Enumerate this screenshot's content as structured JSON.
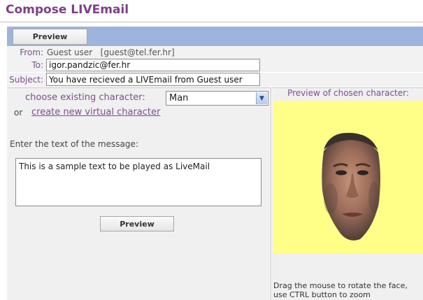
{
  "header": {
    "title": "Compose LIVEmail"
  },
  "toolbar": {
    "preview_label": "Preview"
  },
  "form": {
    "from_label": "From:",
    "from_value": "Guest user   [guest@tel.fer.hr]",
    "to_label": "To:",
    "to_value": "igor.pandzic@fer.hr",
    "subject_label": "Subject:",
    "subject_value": "You have recieved a LIVEmail from Guest user"
  },
  "character": {
    "choose_label": "choose existing character:",
    "selected": "Man",
    "or_label": "or",
    "create_link": "create new virtual character"
  },
  "message": {
    "prompt": "Enter the text of the message:",
    "text": "This is a sample text to be played as LiveMail",
    "preview_label": "Preview"
  },
  "preview_panel": {
    "title": "Preview of chosen character:",
    "hint": "Drag the mouse to rotate the face, use CTRL button to zoom",
    "background_color": "#ffff88"
  },
  "colors": {
    "accent": "#7e3f86",
    "toolbar": "#9db5dc"
  }
}
